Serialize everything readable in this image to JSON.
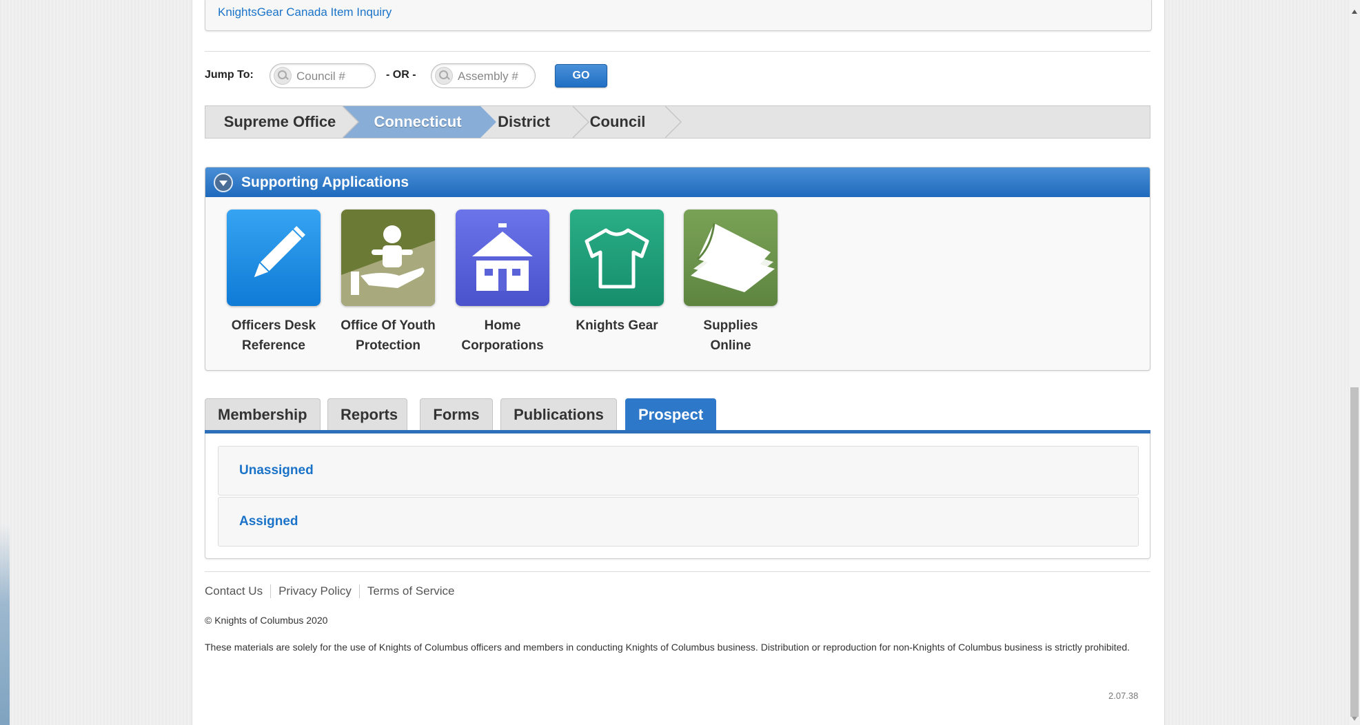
{
  "top_link": "KnightsGear Canada Item Inquiry",
  "jump": {
    "label": "Jump To:",
    "council_placeholder": "Council #",
    "or_label": "- OR -",
    "assembly_placeholder": "Assembly #",
    "go_label": "GO"
  },
  "breadcrumb": [
    "Supreme Office",
    "Connecticut",
    "District",
    "Council"
  ],
  "supporting_apps": {
    "title": "Supporting Applications",
    "apps": [
      {
        "line1": "Officers Desk",
        "line2": "Reference",
        "icon": "pencil-icon",
        "color": "#1a8be0"
      },
      {
        "line1": "Office Of Youth",
        "line2": "Protection",
        "icon": "child-hand-icon",
        "color": "#6b7a34"
      },
      {
        "line1": "Home",
        "line2": "Corporations",
        "icon": "house-icon",
        "color": "#5a63d8"
      },
      {
        "line1": "Knights Gear",
        "line2": "",
        "icon": "tshirt-icon",
        "color": "#1f9e7a"
      },
      {
        "line1": "Supplies",
        "line2": "Online",
        "icon": "papers-icon",
        "color": "#6e9448"
      }
    ]
  },
  "tabs": [
    "Membership",
    "Reports",
    "Forms",
    "Publications",
    "Prospect"
  ],
  "active_tab": "Prospect",
  "prospect_items": [
    "Unassigned",
    "Assigned"
  ],
  "footer": {
    "links": [
      "Contact Us",
      "Privacy Policy",
      "Terms of Service"
    ],
    "copyright": "© Knights of Columbus 2020",
    "disclaimer": "These materials are solely for the use of Knights of Columbus officers and members in conducting Knights of Columbus business. Distribution or reproduction for non-Knights of Columbus business is strictly prohibited.",
    "version": "2.07.38"
  }
}
